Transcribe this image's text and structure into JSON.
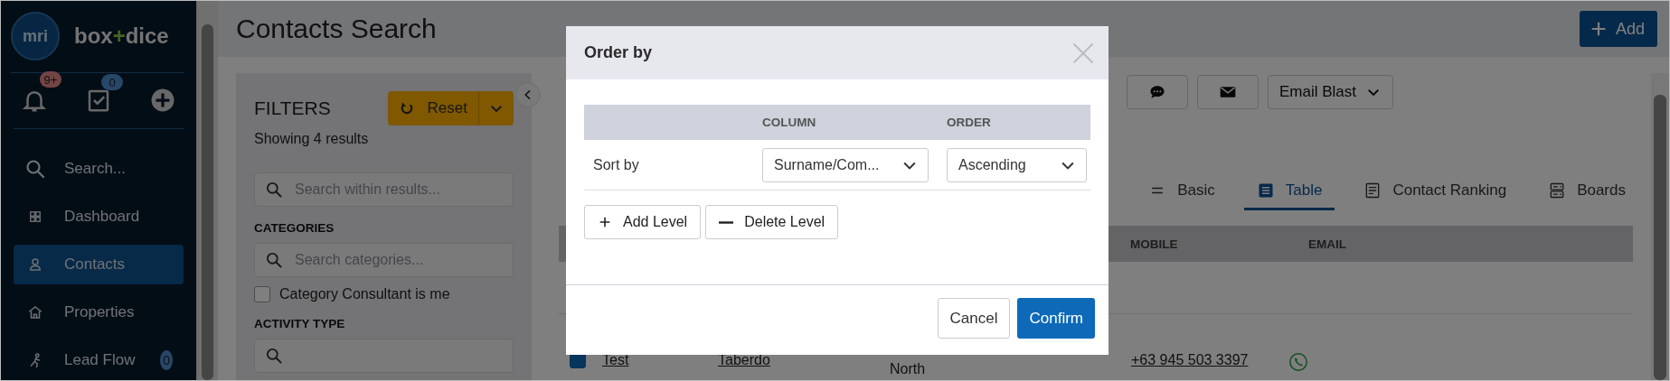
{
  "sidebar": {
    "logo": {
      "badge": "mri",
      "word_left": "box",
      "word_plus": "+",
      "word_right": "dice"
    },
    "quick_actions": [
      {
        "kind": "bell",
        "badge": "9+"
      },
      {
        "kind": "tasks",
        "badge": "0"
      },
      {
        "kind": "add"
      }
    ],
    "items": [
      {
        "label": "Search...",
        "kind": "search",
        "selected": false
      },
      {
        "label": "Dashboard",
        "kind": "grid",
        "selected": false
      },
      {
        "label": "Contacts",
        "kind": "person",
        "selected": true
      },
      {
        "label": "Properties",
        "kind": "house",
        "selected": false
      },
      {
        "label": "Lead Flow",
        "kind": "runner",
        "selected": false,
        "badge": "0"
      }
    ]
  },
  "header": {
    "title": "Contacts Search",
    "add_button": "Add"
  },
  "filters": {
    "title": "FILTERS",
    "reset_button": "Reset",
    "result_count": "Showing 4 results",
    "search": {
      "placeholder": "Search within results..."
    },
    "categories": {
      "title": "CATEGORIES",
      "search": {
        "placeholder": "Search categories..."
      },
      "checkbox": {
        "label": "Category Consultant is me",
        "checked": false
      }
    },
    "activity_type": {
      "title": "ACTIVITY TYPE"
    }
  },
  "toolbar": {
    "buttons": [
      {
        "kind": "chat"
      },
      {
        "kind": "mail"
      }
    ],
    "email_blast": "Email Blast"
  },
  "view_tabs": [
    {
      "label": "Basic",
      "kind": "lines",
      "selected": false
    },
    {
      "label": "Table",
      "kind": "table",
      "selected": true
    },
    {
      "label": "Contact Ranking",
      "kind": "doc",
      "selected": false
    },
    {
      "label": "Boards",
      "kind": "boards",
      "selected": false
    }
  ],
  "table": {
    "columns": [
      "MOBILE",
      "EMAIL"
    ],
    "rows": [
      {
        "checked": true,
        "first_name": "Test",
        "surname": "Taberdo",
        "suburb": "North",
        "mobile": "+63 945 503 3397"
      }
    ]
  },
  "modal": {
    "title": "Order by",
    "columns": [
      "COLUMN",
      "ORDER"
    ],
    "levels": [
      {
        "label": "Sort by",
        "column": "Surname/Com...",
        "order": "Ascending"
      }
    ],
    "actions": [
      {
        "kind": "add",
        "label": "Add Level"
      },
      {
        "kind": "delete",
        "label": "Delete Level"
      }
    ],
    "cancel": "Cancel",
    "confirm": "Confirm"
  }
}
